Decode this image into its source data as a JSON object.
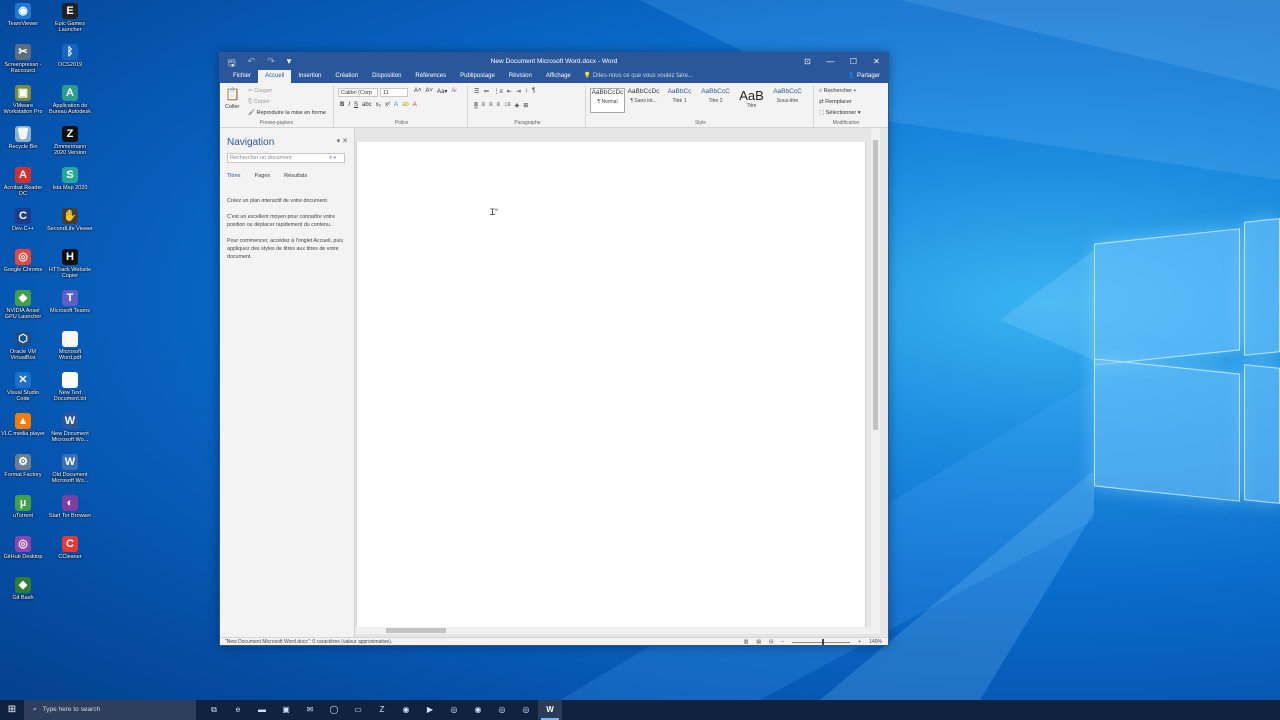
{
  "colors": {
    "word_blue": "#2b579a",
    "taskbar": "#0f2240",
    "desktop_accent": "#1d8fe0"
  },
  "desktop": {
    "icons": [
      {
        "label": "TeamViewer",
        "icon": "teamviewer-icon",
        "color": "#1f7ad6",
        "glyph": "◉"
      },
      {
        "label": "Epic Games Launcher",
        "icon": "epic-games-icon",
        "color": "#222222",
        "glyph": "E"
      },
      {
        "label": "Screenpresso - Raccourci",
        "icon": "screenpresso-icon",
        "color": "#5a6e7e",
        "glyph": "✂"
      },
      {
        "label": "OCS2019",
        "icon": "bluetooth-icon",
        "color": "#1565c0",
        "glyph": "ᛒ"
      },
      {
        "label": "VMware Workstation Pro",
        "icon": "vmware-icon",
        "color": "#7a8d3c",
        "glyph": "▣"
      },
      {
        "label": "Application de Bureau Autodesk",
        "icon": "autodesk-icon",
        "color": "#2a9d8f",
        "glyph": "A"
      },
      {
        "label": "Recycle Bin",
        "icon": "recycle-bin-icon",
        "color": "#8fb0c8",
        "glyph": "🗑"
      },
      {
        "label": "Zimmermann 2020 Version",
        "icon": "zimmermann-icon",
        "color": "#111111",
        "glyph": "Z"
      },
      {
        "label": "Acrobat Reader DC",
        "icon": "acrobat-icon",
        "color": "#d32f2f",
        "glyph": "A"
      },
      {
        "label": "Ista Map 2020",
        "icon": "ista-map-icon",
        "color": "#26a69a",
        "glyph": "S"
      },
      {
        "label": "Dev-C++",
        "icon": "devcpp-icon",
        "color": "#1e3a8a",
        "glyph": "C"
      },
      {
        "label": "SecondLife Viewer",
        "icon": "secondlife-icon",
        "color": "#3e3e3e",
        "glyph": "✋"
      },
      {
        "label": "Google Chrome",
        "icon": "chrome-icon",
        "color": "#e8453c",
        "glyph": "◎"
      },
      {
        "label": "HTTrack Website Copier",
        "icon": "httrack-icon",
        "color": "#111111",
        "glyph": "H"
      },
      {
        "label": "NVIDIA Ansel GPU Launcher",
        "icon": "nvidia-icon",
        "color": "#43a047",
        "glyph": "◆"
      },
      {
        "label": "Microsoft Teams",
        "icon": "teams-icon",
        "color": "#5b5fc7",
        "glyph": "T"
      },
      {
        "label": "Oracle VM VirtualBox",
        "icon": "virtualbox-icon",
        "color": "#1a4f8b",
        "glyph": "⬡"
      },
      {
        "label": "Microsoft Word.pdf",
        "icon": "pdf-file-icon",
        "color": "#f5f5f5",
        "glyph": "⎘"
      },
      {
        "label": "Visual Studio Code",
        "icon": "vscode-icon",
        "color": "#1f6fcc",
        "glyph": "✕"
      },
      {
        "label": "New Text Document.txt",
        "icon": "text-file-icon",
        "color": "#ffffff",
        "glyph": "≡"
      },
      {
        "label": "VLC media player",
        "icon": "vlc-icon",
        "color": "#f57c00",
        "glyph": "▲"
      },
      {
        "label": "New Document Microsoft Wo...",
        "icon": "word-file-icon",
        "color": "#2b579a",
        "glyph": "W"
      },
      {
        "label": "Format Factory",
        "icon": "format-factory-icon",
        "color": "#6d7d8a",
        "glyph": "⚙"
      },
      {
        "label": "Old Document Microsoft Wo...",
        "icon": "word-file-icon",
        "color": "#3a6fb5",
        "glyph": "W"
      },
      {
        "label": "uTorrent",
        "icon": "utorrent-icon",
        "color": "#43a047",
        "glyph": "µ"
      },
      {
        "label": "Start Tor Browser",
        "icon": "tor-icon",
        "color": "#7b3fa0",
        "glyph": "◐"
      },
      {
        "label": "GitHub Desktop",
        "icon": "github-icon",
        "color": "#8e44ad",
        "glyph": "◎"
      },
      {
        "label": "CCleaner",
        "icon": "ccleaner-icon",
        "color": "#e53935",
        "glyph": "C"
      },
      {
        "label": "Git Bash",
        "icon": "git-bash-icon",
        "color": "#2e7d32",
        "glyph": "◆"
      }
    ]
  },
  "word": {
    "window_title": "New Document Microsoft Word.docx - Word",
    "tabs": [
      "Fichier",
      "Accueil",
      "Insertion",
      "Création",
      "Disposition",
      "Références",
      "Publipostage",
      "Révision",
      "Affichage"
    ],
    "active_tab": "Accueil",
    "tell_me": "Dites-nous ce que vous voulez faire...",
    "share": "Partager",
    "clipboard": {
      "paste": "Coller",
      "cut": "Couper",
      "copy": "Copier",
      "format_painter": "Reproduire la mise en forme",
      "group": "Presse-papiers"
    },
    "font": {
      "name": "Calibri (Corp",
      "size": "11",
      "group": "Police"
    },
    "paragraph": {
      "group": "Paragraphe"
    },
    "styles": {
      "group": "Style",
      "items": [
        {
          "sample": "AaBbCcDc",
          "name": "¶ Normal"
        },
        {
          "sample": "AaBbCcDc",
          "name": "¶ Sans int..."
        },
        {
          "sample": "AaBbCc",
          "name": "Titre 1"
        },
        {
          "sample": "AaBbCcC",
          "name": "Titre 2"
        },
        {
          "sample": "AaB",
          "name": "Titre"
        },
        {
          "sample": "AaBbCcC",
          "name": "Sous-titre"
        }
      ]
    },
    "editing": {
      "find": "Rechercher",
      "replace": "Remplacer",
      "select": "Sélectionner",
      "group": "Modification"
    },
    "navigation": {
      "title": "Navigation",
      "search_placeholder": "Rechercher un document",
      "tabs": [
        "Titres",
        "Pages",
        "Résultats"
      ],
      "text": [
        "Créez un plan interactif de votre document.",
        "C'est un excellent moyen pour connaître votre position ou déplacer rapidement du contenu.",
        "Pour commencer, accédez à l'onglet Accueil, puis appliquez des styles de titres aux titres de votre document."
      ]
    },
    "status": "\"New Document Microsoft Word.docx\": 0 caractères (valeur approximative).",
    "zoom": "140%"
  },
  "taskbar": {
    "search_placeholder": "Type here to search",
    "apps": [
      {
        "icon": "task-view-icon",
        "glyph": "⧉"
      },
      {
        "icon": "edge-icon",
        "glyph": "e"
      },
      {
        "icon": "file-explorer-icon",
        "glyph": "▬"
      },
      {
        "icon": "store-icon",
        "glyph": "▣"
      },
      {
        "icon": "mail-icon",
        "glyph": "✉"
      },
      {
        "icon": "xbox-icon",
        "glyph": "◯"
      },
      {
        "icon": "terminal-icon",
        "glyph": "▭"
      },
      {
        "icon": "filezilla-icon",
        "glyph": "Z"
      },
      {
        "icon": "github-desktop-icon",
        "glyph": "◉"
      },
      {
        "icon": "zoom-icon",
        "glyph": "▶"
      },
      {
        "icon": "chrome-icon",
        "glyph": "◎"
      },
      {
        "icon": "camera-app-icon",
        "glyph": "◉"
      },
      {
        "icon": "chrome-icon",
        "glyph": "◎"
      },
      {
        "icon": "chrome-icon",
        "glyph": "◎"
      },
      {
        "icon": "word-icon",
        "glyph": "W",
        "active": true
      }
    ]
  }
}
